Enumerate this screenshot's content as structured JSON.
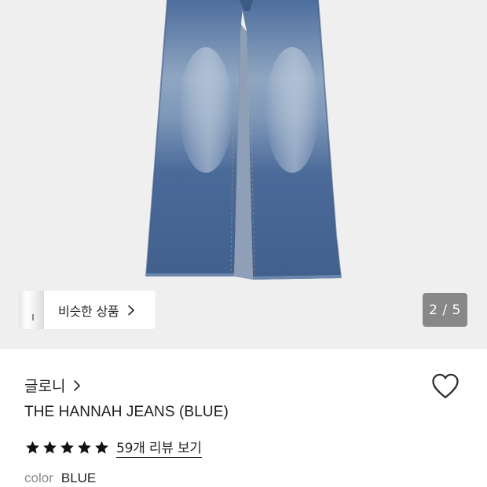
{
  "gallery": {
    "similar_label": "비슷한 상품",
    "page_counter": "2 / 5",
    "current_page": 2,
    "total_pages": 5
  },
  "product": {
    "brand": "글로니",
    "name": "THE HANNAH JEANS (BLUE)",
    "rating_stars": 5,
    "reviews_link": "59개 리뷰 보기",
    "color_label": "color",
    "color_value": "BLUE"
  },
  "colors": {
    "denim": "#4f6f9f",
    "denim_light": "#9fb3cb",
    "counter_bg": "#5f5f5f",
    "star": "#111111"
  },
  "icons": [
    "chevron-right-icon",
    "heart-outline-icon",
    "star-icon"
  ]
}
